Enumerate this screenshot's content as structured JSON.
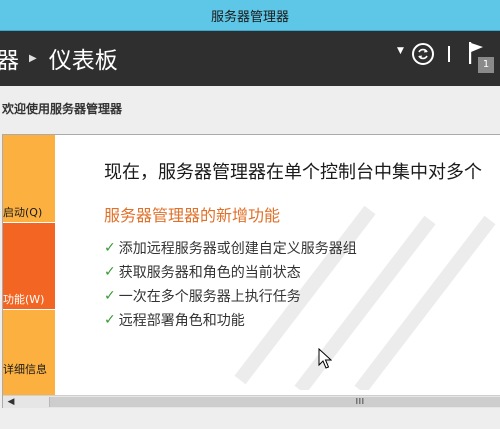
{
  "window": {
    "title": "服务器管理器"
  },
  "header": {
    "breadcrumb_root": "器",
    "breadcrumb_current": "仪表板",
    "notification_count": "1"
  },
  "welcome": {
    "section_label": "欢迎使用服务器管理器",
    "sidebar": [
      {
        "label": "启动(Q)"
      },
      {
        "label": "功能(W)"
      },
      {
        "label": "详细信息"
      }
    ],
    "headline": "现在，服务器管理器在单个控制台中集中对多个",
    "subtitle": "服务器管理器的新增功能",
    "features": [
      "添加远程服务器或创建自定义服务器组",
      "获取服务器和角色的当前状态",
      "一次在多个服务器上执行任务",
      "远程部署角色和功能"
    ]
  },
  "colors": {
    "titlebar": "#5ec6e6",
    "header": "#2f2f2f",
    "tile_orange": "#fbb040",
    "tile_active": "#f26522",
    "subtitle": "#e0712a",
    "check": "#3a9a3a"
  },
  "icons": {
    "separator": "chevron-right-icon",
    "dropdown": "dropdown-arrow-icon",
    "refresh": "refresh-icon",
    "flag": "notification-flag-icon",
    "check": "checkmark-icon"
  }
}
